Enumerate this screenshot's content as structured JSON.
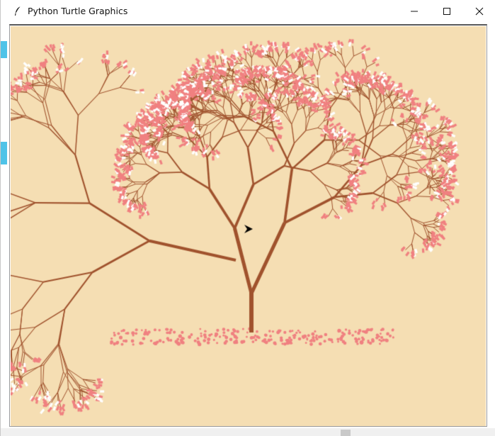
{
  "window": {
    "title": "Python Turtle Graphics",
    "app_icon": "feather-icon",
    "controls": [
      "minimize-icon",
      "maximize-icon",
      "close-icon"
    ]
  },
  "canvas": {
    "background_color": "#f5deb3",
    "trunk_color": "#a0522d",
    "blossom_color": "#f08080",
    "highlight_color": "#ffffff",
    "turtle_color": "#000000"
  }
}
